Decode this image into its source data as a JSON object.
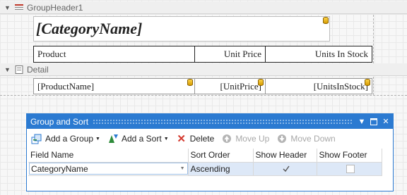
{
  "group_header": {
    "band_label": "GroupHeader1",
    "category_field": "[CategoryName]",
    "columns": [
      "Product",
      "Unit Price",
      "Units In Stock"
    ]
  },
  "detail": {
    "band_label": "Detail",
    "fields": [
      "[ProductName]",
      "[UnitPrice]",
      "[UnitsInStock]"
    ]
  },
  "group_sort_panel": {
    "title": "Group and Sort",
    "toolbar": {
      "add_group": "Add a Group",
      "add_sort": "Add a Sort",
      "delete": "Delete",
      "move_up": "Move Up",
      "move_down": "Move Down"
    },
    "columns": [
      "Field Name",
      "Sort Order",
      "Show Header",
      "Show Footer"
    ],
    "rows": [
      {
        "field_name": "CategoryName",
        "sort_order": "Ascending",
        "show_header": true,
        "show_footer": false
      }
    ]
  },
  "colors": {
    "accent": "#2b7ad1",
    "selected_row": "#dde8f7",
    "db_icon": "#f2b705"
  }
}
